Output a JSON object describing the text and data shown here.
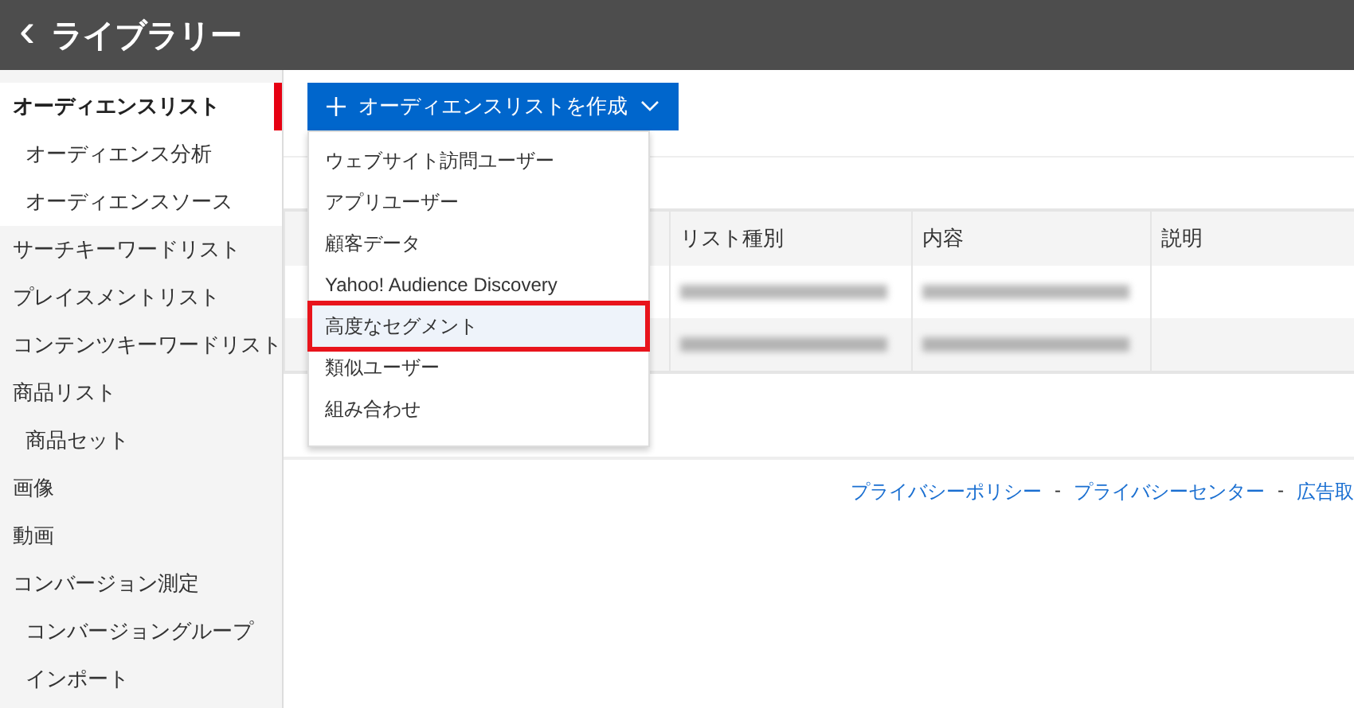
{
  "header": {
    "back": "‹",
    "title": "ライブラリー"
  },
  "sidebar": {
    "items": [
      {
        "label": "オーディエンスリスト",
        "selected": true,
        "children": [
          {
            "label": "オーディエンス分析",
            "selected": false
          },
          {
            "label": "オーディエンスソース",
            "selected": false
          }
        ]
      },
      {
        "label": "サーチキーワードリスト",
        "selected": false
      },
      {
        "label": "プレイスメントリスト",
        "selected": false
      },
      {
        "label": "コンテンツキーワードリスト",
        "selected": false
      },
      {
        "label": "商品リスト",
        "selected": false,
        "children": [
          {
            "label": "商品セット",
            "selected": false
          }
        ]
      },
      {
        "label": "画像",
        "selected": false
      },
      {
        "label": "動画",
        "selected": false
      },
      {
        "label": "コンバージョン測定",
        "selected": false,
        "children": [
          {
            "label": "コンバージョングループ",
            "selected": false
          },
          {
            "label": "インポート",
            "selected": false
          }
        ]
      }
    ]
  },
  "create_button": {
    "label": "オーディエンスリストを作成",
    "expanded": true
  },
  "dropdown": {
    "items": [
      {
        "label": "ウェブサイト訪問ユーザー",
        "selected": false
      },
      {
        "label": "アプリユーザー",
        "selected": false
      },
      {
        "label": "顧客データ",
        "selected": false
      },
      {
        "label": "Yahoo! Audience Discovery",
        "selected": false
      },
      {
        "label": "高度なセグメント",
        "selected": true
      },
      {
        "label": "類似ユーザー",
        "selected": false
      },
      {
        "label": "組み合わせ",
        "selected": false
      }
    ]
  },
  "table": {
    "columns": [
      "リスト種別",
      "内容",
      "説明"
    ],
    "rows": [
      {
        "kind": "blurred"
      },
      {
        "kind": "blurred"
      }
    ]
  },
  "footer": {
    "links": [
      "プライバシーポリシー",
      "プライバシーセンター",
      "広告取"
    ],
    "separator": "-"
  }
}
